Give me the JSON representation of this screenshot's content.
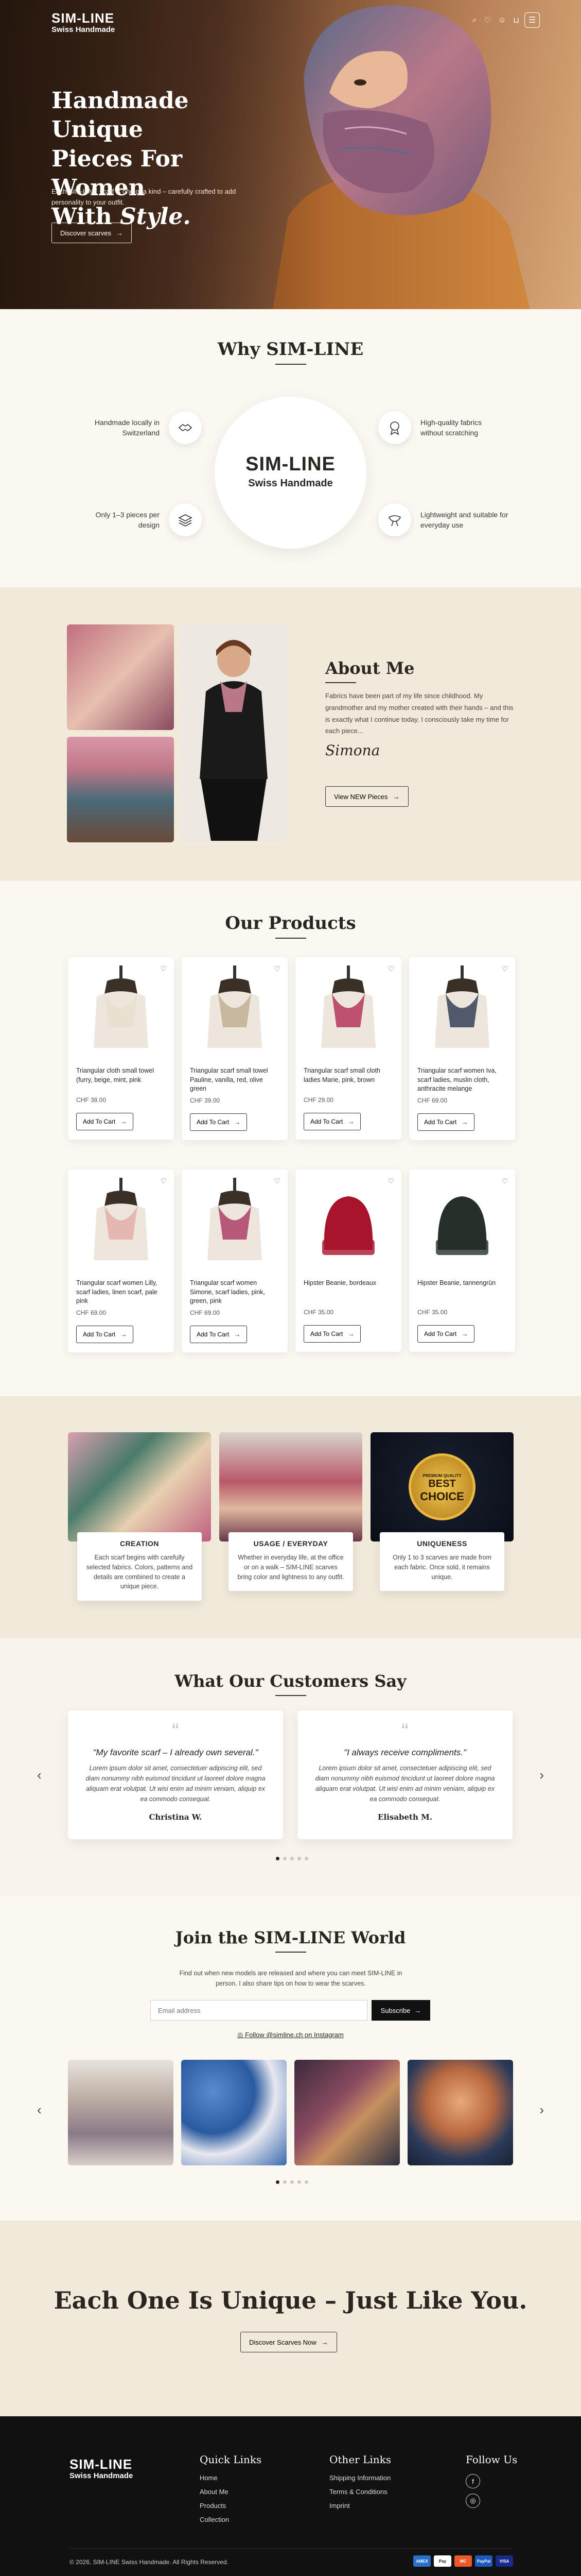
{
  "brand": {
    "name": "SIM-LINE",
    "sub": "Swiss Handmade"
  },
  "header": {
    "icons": [
      "search-icon",
      "heart-icon",
      "user-icon",
      "cart-icon",
      "menu-icon"
    ]
  },
  "hero": {
    "title_line1": "Handmade Unique",
    "title_line2": "Pieces For Women",
    "title_with": "With",
    "title_style": "Style.",
    "text": "Each SIM-LINE scarf is one of a kind – carefully crafted to add personality to your outfit.",
    "button": "Discover scarves"
  },
  "why": {
    "title": "Why SIM-LINE",
    "features": [
      {
        "text": "Handmade locally in Switzerland",
        "icon": "handshake-icon"
      },
      {
        "text": "High-quality fabrics without scratching",
        "icon": "badge-icon"
      },
      {
        "text": "Only 1–3 pieces per design",
        "icon": "layers-icon"
      },
      {
        "text": "Lightweight and suitable for everyday use",
        "icon": "scarf-icon"
      }
    ]
  },
  "about": {
    "title": "About Me",
    "text": "Fabrics have been part of my life since childhood. My grandmother and my mother created with their hands – and this is exactly what I continue today. I consciously take my time for each piece...",
    "signature": "Simona",
    "button": "View NEW Pieces"
  },
  "products": {
    "title": "Our Products",
    "add_label": "Add To Cart",
    "items": [
      {
        "name": "Triangular cloth small towel (furry, beige, mint, pink",
        "price": "CHF 38.00",
        "color": "#e8e0d0"
      },
      {
        "name": "Triangular scarf small towel Pauline, vanilla, red, olive green",
        "price": "CHF 39.00",
        "color": "#c9b8a0"
      },
      {
        "name": "Triangular scarf small cloth ladies Marie, pink, brown",
        "price": "CHF 29.00",
        "color": "#c05070"
      },
      {
        "name": "Triangular scarf women Iva, scarf ladies, muslin cloth, anthracite melange",
        "price": "CHF 69.00",
        "color": "#505a6a"
      },
      {
        "name": "Triangular scarf women Lilly, scarf ladies, linen scarf, pale pink",
        "price": "CHF 69.00",
        "color": "#e4b8b0"
      },
      {
        "name": "Triangular scarf women Simone, scarf ladies, pink, green, pink",
        "price": "CHF 69.00",
        "color": "#b85878"
      },
      {
        "name": "Hipster Beanie, bordeaux",
        "price": "CHF 35.00",
        "color": "#a8142a"
      },
      {
        "name": "Hipster Beanie, tannengrün",
        "price": "CHF 35.00",
        "color": "#26302a"
      }
    ]
  },
  "features": [
    {
      "title": "CREATION",
      "text": "Each scarf begins with carefully selected fabrics. Colors, patterns and details are combined to create a unique piece."
    },
    {
      "title": "USAGE / EVERYDAY",
      "text": "Whether in everyday life, at the office or on a walk – SIM-LINE scarves bring color and lightness to any outfit."
    },
    {
      "title": "UNIQUENESS",
      "text": "Only 1 to 3 scarves are made from each fabric. Once sold, it remains unique."
    }
  ],
  "choice_badge": {
    "line1": "PREMIUM QUALITY",
    "line2": "BEST",
    "line3": "CHOICE"
  },
  "testimonials": {
    "title": "What Our Customers Say",
    "items": [
      {
        "title": "\"My favorite scarf – I already own several.\"",
        "body": "Lorem ipsum dolor sit amet, consectetuer adipiscing elit, sed diam nonummy nibh euismod tincidunt ut laoreet dolore magna aliquam erat volutpat. Ut wisi enim ad minim veniam, aliquip ex ea commodo consequat.",
        "name": "Christina W."
      },
      {
        "title": "\"I always receive compliments.\"",
        "body": "Lorem ipsum dolor sit amet, consectetuer adipiscing elit, sed diam nonummy nibh euismod tincidunt ut laoreet dolore magna aliquam erat volutpat. Ut wisi enim ad minim veniam, aliquip ex ea commodo consequat.",
        "name": "Elisabeth M."
      }
    ]
  },
  "join": {
    "title": "Join the SIM-LINE World",
    "text": "Find out when new models are released and where you can meet SIM-LINE in person. I also share tips on how to wear the scarves.",
    "placeholder": "Email address",
    "button": "Subscribe",
    "instagram": "Follow @simline.ch on Instagram"
  },
  "cta": {
    "title": "Each One Is Unique – Just Like You.",
    "button": "Discover Scarves Now"
  },
  "footer": {
    "quick_title": "Quick Links",
    "quick": [
      "Home",
      "About Me",
      "Products",
      "Collection"
    ],
    "other_title": "Other Links",
    "other": [
      "Shipping Information",
      "Terms & Conditions",
      "Imprint"
    ],
    "follow_title": "Follow Us",
    "copyright": "© 2026, SIM-LINE Swiss Handmade. All Rights Reserved.",
    "payments": [
      "AMEX",
      "Pay",
      "MC",
      "PayPal",
      "VISA"
    ]
  },
  "colors": {
    "accent": "#2a2520",
    "cream": "#faf6ee",
    "sand": "#f1eadb",
    "footer": "#111111"
  }
}
